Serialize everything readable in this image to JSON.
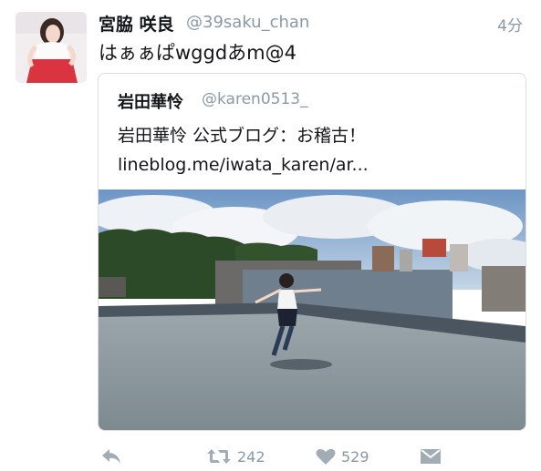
{
  "tweet": {
    "author_name": "宮脇 咲良",
    "author_handle": "@39saku_chan",
    "timestamp": "4分",
    "text": "はぁぁぱwggdあm@4"
  },
  "quoted_tweet": {
    "author_name": "岩田華怜",
    "author_handle": "@karen0513_",
    "text_line1": "岩田華怜 公式ブログ：お稽古！",
    "text_line2": "lineblog.me/iwata_karen/ar..."
  },
  "actions": {
    "retweet_count": "242",
    "like_count": "529"
  },
  "icons": {
    "reply": "reply-icon",
    "retweet": "retweet-icon",
    "like": "heart-icon",
    "message": "direct-message-icon"
  },
  "colors": {
    "secondary_text": "#8b98a5",
    "action_icon": "#a3acb5",
    "border": "#d8dee3"
  }
}
